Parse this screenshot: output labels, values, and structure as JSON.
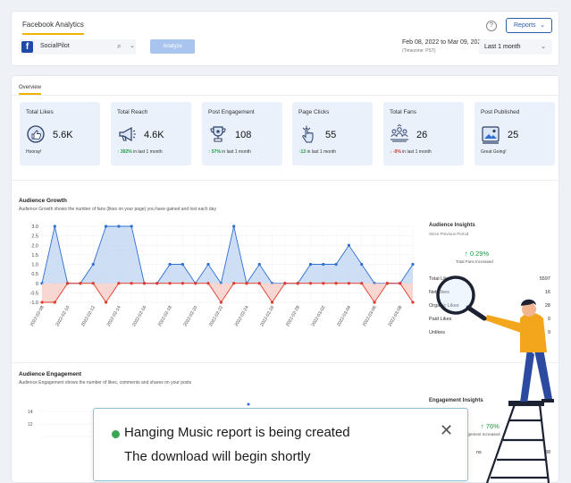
{
  "header": {
    "tab": "Facebook Analytics",
    "help_icon": "help-circle-icon",
    "reports_label": "Reports",
    "page_name": "SocialPilot",
    "analyze_label": "Analyze",
    "date_range": "Feb 08, 2022 to Mar 09, 2022",
    "timezone": "(Timezone: PST)",
    "range_option": "Last 1 month"
  },
  "overview": {
    "tab": "Overview",
    "cards": [
      {
        "title": "Total Likes",
        "value": "5.6K",
        "foot": "Hooray!",
        "icon": "like-badge-icon"
      },
      {
        "title": "Total Reach",
        "value": "4.6K",
        "change": "392%",
        "foot": "in last 1 month",
        "trend": "up",
        "icon": "megaphone-icon"
      },
      {
        "title": "Post Engagement",
        "value": "108",
        "change": "57%",
        "foot": "in last 1 month",
        "trend": "up",
        "icon": "trophy-icon"
      },
      {
        "title": "Page Clicks",
        "value": "55",
        "change": "13",
        "foot": "in last 1 month",
        "trend": "up",
        "icon": "hand-click-icon"
      },
      {
        "title": "Total Fans",
        "value": "26",
        "change": "-9%",
        "foot": "in last 1 month",
        "trend": "down",
        "icon": "group-icon"
      },
      {
        "title": "Post Published",
        "value": "25",
        "foot": "Great Going!",
        "icon": "image-post-icon"
      }
    ]
  },
  "growth": {
    "title": "Audience Growth",
    "desc": "Audience Growth shows the number of fans (likes on your page) you have gained and lost each day"
  },
  "insights": {
    "title": "Audience Insights",
    "sub": "Since Previous Period",
    "pct": "0.29%",
    "pct_label": "Total Fans Increased",
    "rows": [
      {
        "label": "Total Likes",
        "value": "5597"
      },
      {
        "label": "Net Likes",
        "value": "16"
      },
      {
        "label": "Organic Likes",
        "value": "28"
      },
      {
        "label": "Paid Likes",
        "value": "0"
      },
      {
        "label": "Unlikes",
        "value": "9"
      }
    ]
  },
  "engagement": {
    "title": "Audience Engagement",
    "desc": "Audience Engagement shows the number of likes, comments and shares on your posts",
    "insights_title": "Engagement Insights",
    "pct": "76%",
    "pct_label": "Engagement Increased",
    "last_row_label": "ns",
    "last_row_value": "38"
  },
  "toast": {
    "title": "Hanging Music report is being created",
    "sub": "The download will begin shortly",
    "close_icon": "close-icon",
    "status_color": "#3aa552"
  },
  "chart_data": {
    "type": "area",
    "title": "Audience Growth",
    "ylim": [
      -1.0,
      3.0
    ],
    "yticks": [
      "3.0",
      "2.5",
      "2.0",
      "1.5",
      "1.0",
      "0.5",
      "0",
      "-0.5",
      "-1.0"
    ],
    "x_tick_labels": [
      "2022-02-08",
      "2022-02-10",
      "2022-02-12",
      "2022-02-14",
      "2022-02-16",
      "2022-02-18",
      "2022-02-20",
      "2022-02-22",
      "2022-02-24",
      "2022-02-26",
      "2022-02-28",
      "2022-03-02",
      "2022-03-04",
      "2022-03-06",
      "2022-03-08"
    ],
    "series": [
      {
        "values": [
          0,
          3,
          0,
          0,
          1,
          3,
          3,
          3,
          0,
          0,
          1,
          1,
          0,
          1,
          0,
          3,
          0,
          1,
          0,
          0,
          0,
          1,
          1,
          1,
          2,
          1,
          0,
          0,
          0,
          1
        ],
        "color": "#2e6fd0"
      },
      {
        "values": [
          -1,
          -1,
          0,
          0,
          0,
          -1,
          0,
          0,
          0,
          0,
          0,
          0,
          0,
          0,
          -1,
          0,
          0,
          0,
          -1,
          0,
          0,
          0,
          0,
          0,
          0,
          0,
          -1,
          0,
          0,
          -1
        ],
        "color": "#e23a2c"
      }
    ]
  }
}
